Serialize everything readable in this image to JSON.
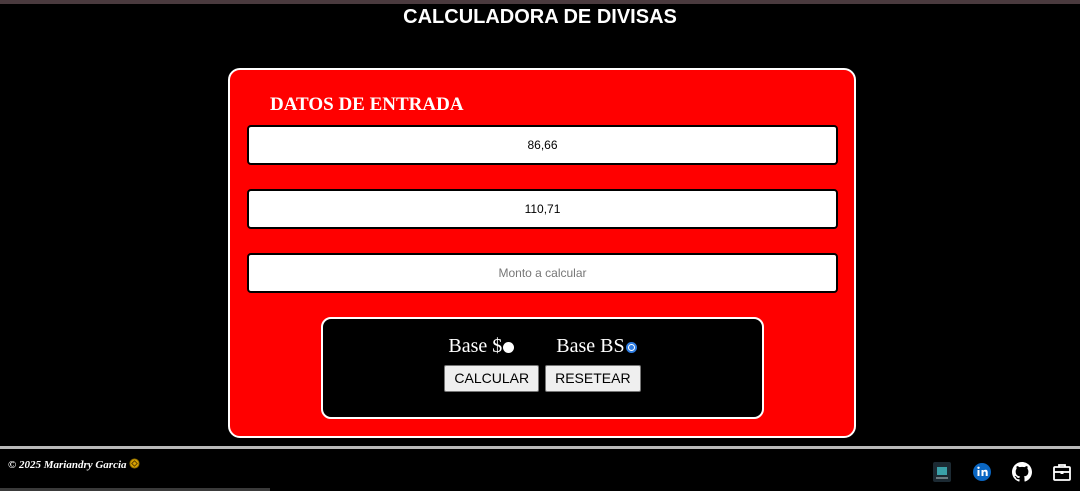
{
  "header": {
    "title": "CALCULADORA DE DIVISAS"
  },
  "form": {
    "heading": "DATOS DE ENTRADA",
    "rate_usd": {
      "value": "86,66"
    },
    "rate_eur": {
      "value": "110,71"
    },
    "amount": {
      "value": "",
      "placeholder": "Monto a calcular"
    },
    "options": {
      "base_usd_label": "Base $",
      "base_bs_label": "Base BS",
      "selected": "Base BS"
    },
    "buttons": {
      "calculate": "CALCULAR",
      "reset": "RESETEAR"
    }
  },
  "footer": {
    "copyright": "© 2025 Mariandry Garcia",
    "icons": [
      "app-icon",
      "linkedin-icon",
      "github-icon",
      "portfolio-icon"
    ]
  },
  "colors": {
    "card_bg": "#ff0000",
    "page_bg": "#000000",
    "radio_accent": "#2f7de1",
    "linkedin": "#0a66c2"
  }
}
